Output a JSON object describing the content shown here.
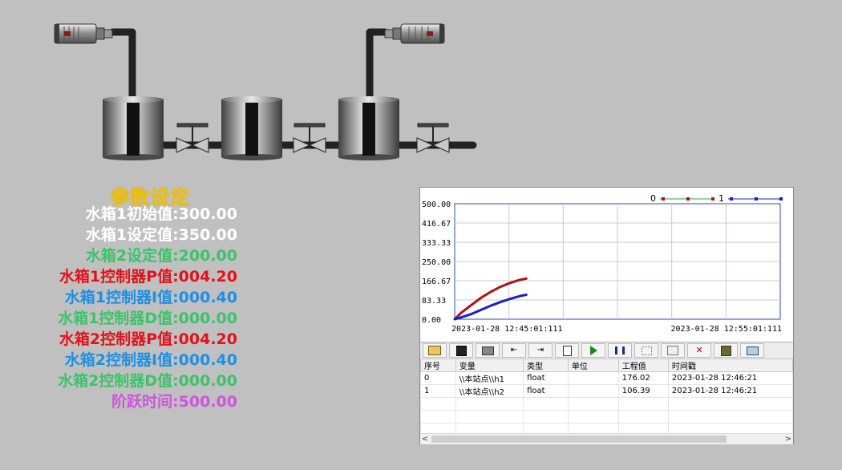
{
  "params": {
    "title": "参数设定",
    "rows": [
      {
        "label": "水箱1初始值:",
        "value": "300.00",
        "color": "#ffffff"
      },
      {
        "label": "水箱1设定值:",
        "value": "350.00",
        "color": "#ffffff"
      },
      {
        "label": "水箱2设定值:",
        "value": "200.00",
        "color": "#3cc36a"
      },
      {
        "label": "水箱1控制器P值:",
        "value": "004.20",
        "color": "#e3121a"
      },
      {
        "label": "水箱1控制器I值:",
        "value": "000.40",
        "color": "#1e8fe6"
      },
      {
        "label": "水箱1控制器D值:",
        "value": "000.00",
        "color": "#3cc36a"
      },
      {
        "label": "水箱2控制器P值:",
        "value": "004.20",
        "color": "#e3121a"
      },
      {
        "label": "水箱2控制器I值:",
        "value": "000.40",
        "color": "#1e8fe6"
      },
      {
        "label": "水箱2控制器D值:",
        "value": "000.00",
        "color": "#3cc36a"
      },
      {
        "label": "阶跃时间:",
        "value": "500.00",
        "color": "#cc55dd"
      }
    ]
  },
  "chart_data": {
    "type": "line",
    "ylim": [
      0,
      500
    ],
    "yticks": [
      "500.00",
      "416.67",
      "333.33",
      "250.00",
      "166.67",
      "83.33",
      "0.00"
    ],
    "x_start_label": "2023-01-28 12:45:01:111",
    "x_end_label": "2023-01-28 12:55:01:111",
    "legend_position": "top-right",
    "series": [
      {
        "name": "0",
        "color": "#b01010",
        "points": [
          [
            0,
            0
          ],
          [
            0.02,
            28
          ],
          [
            0.05,
            60
          ],
          [
            0.08,
            92
          ],
          [
            0.11,
            118
          ],
          [
            0.14,
            140
          ],
          [
            0.17,
            157
          ],
          [
            0.2,
            170
          ],
          [
            0.22,
            176
          ]
        ]
      },
      {
        "name": "1",
        "color": "#1c1cc8",
        "points": [
          [
            0,
            0
          ],
          [
            0.02,
            8
          ],
          [
            0.05,
            22
          ],
          [
            0.08,
            40
          ],
          [
            0.11,
            58
          ],
          [
            0.14,
            74
          ],
          [
            0.17,
            88
          ],
          [
            0.2,
            100
          ],
          [
            0.22,
            106
          ]
        ]
      }
    ]
  },
  "toolbar": {
    "icons": [
      "open-icon",
      "save-icon",
      "print-icon",
      "first-icon",
      "last-icon",
      "new-icon",
      "play-icon",
      "pause-icon",
      "grid-icon",
      "table-icon",
      "delete-icon",
      "settings-icon",
      "window-icon"
    ]
  },
  "table": {
    "headers": [
      "序号",
      "变量",
      "类型",
      "单位",
      "工程值",
      "时间戳"
    ],
    "rows": [
      [
        "0",
        "\\\\本站点\\\\h1",
        "float",
        "",
        "176.02",
        "2023-01-28 12:46:21"
      ],
      [
        "1",
        "\\\\本站点\\\\h2",
        "float",
        "",
        "106.39",
        "2023-01-28 12:46:21"
      ]
    ]
  },
  "scrollbar": {
    "left": "<",
    "right": ">"
  }
}
